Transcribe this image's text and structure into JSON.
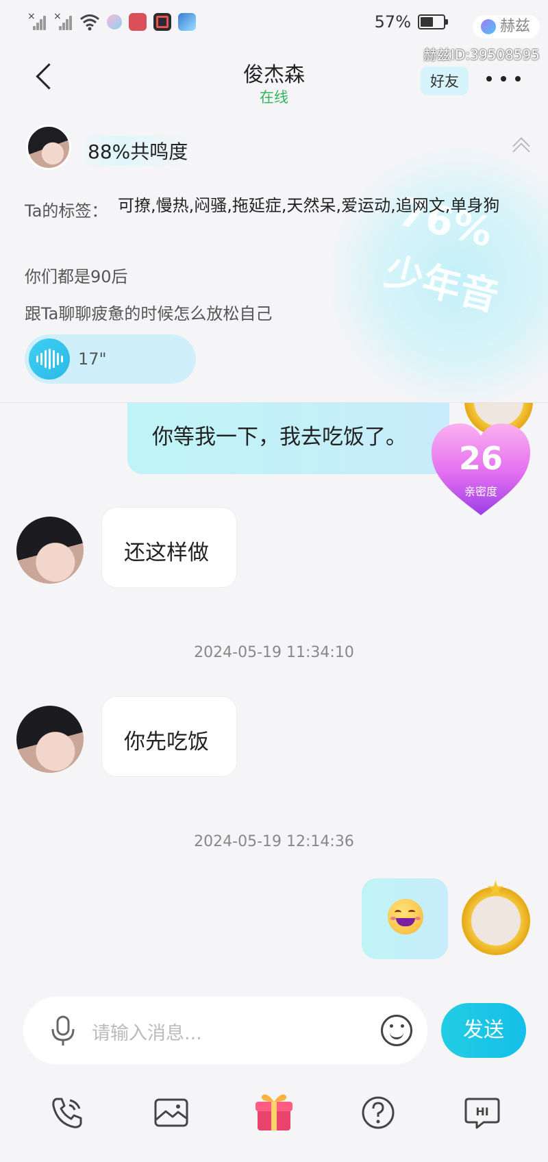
{
  "status_bar": {
    "battery": "57%",
    "battery_level": 0.57,
    "watermark_brand": "赫兹",
    "watermark_id": "赫兹ID:39508595"
  },
  "header": {
    "title": "俊杰森",
    "status": "在线",
    "friend_tag": "好友"
  },
  "profile": {
    "resonance": "88%共鸣度",
    "tags_label": "Ta的标签：",
    "tags_value": "可撩,慢热,闷骚,拖延症,天然呆,爱运动,追网文,单身狗",
    "age_note": "你们都是90后",
    "topic": "跟Ta聊聊疲惫的时候怎么放松自己",
    "voice_duration": "17\"",
    "voice_match_percent": "76%",
    "voice_type": "少年音"
  },
  "chat": {
    "messages": [
      {
        "from": "me",
        "text": "你等我一下，我去吃饭了。"
      },
      {
        "from": "them",
        "text": "还这样做"
      },
      {
        "type": "timestamp",
        "text": "2024-05-19 11:34:10"
      },
      {
        "from": "them",
        "text": "你先吃饭"
      },
      {
        "type": "timestamp",
        "text": "2024-05-19 12:14:36"
      },
      {
        "from": "me",
        "icon": "smiling-emoji"
      }
    ],
    "intimacy": {
      "value": "26",
      "label": "亲密度"
    }
  },
  "input": {
    "placeholder": "请输入消息...",
    "send_label": "发送"
  },
  "toolbar": {
    "icons": [
      "phone-icon",
      "image-icon",
      "gift-icon",
      "question-icon",
      "hi-icon"
    ]
  },
  "colors": {
    "accent": "#14bfe9",
    "online": "#2fb85a",
    "my_bubble": "#c8ecfb",
    "heart": "#d45af2"
  }
}
